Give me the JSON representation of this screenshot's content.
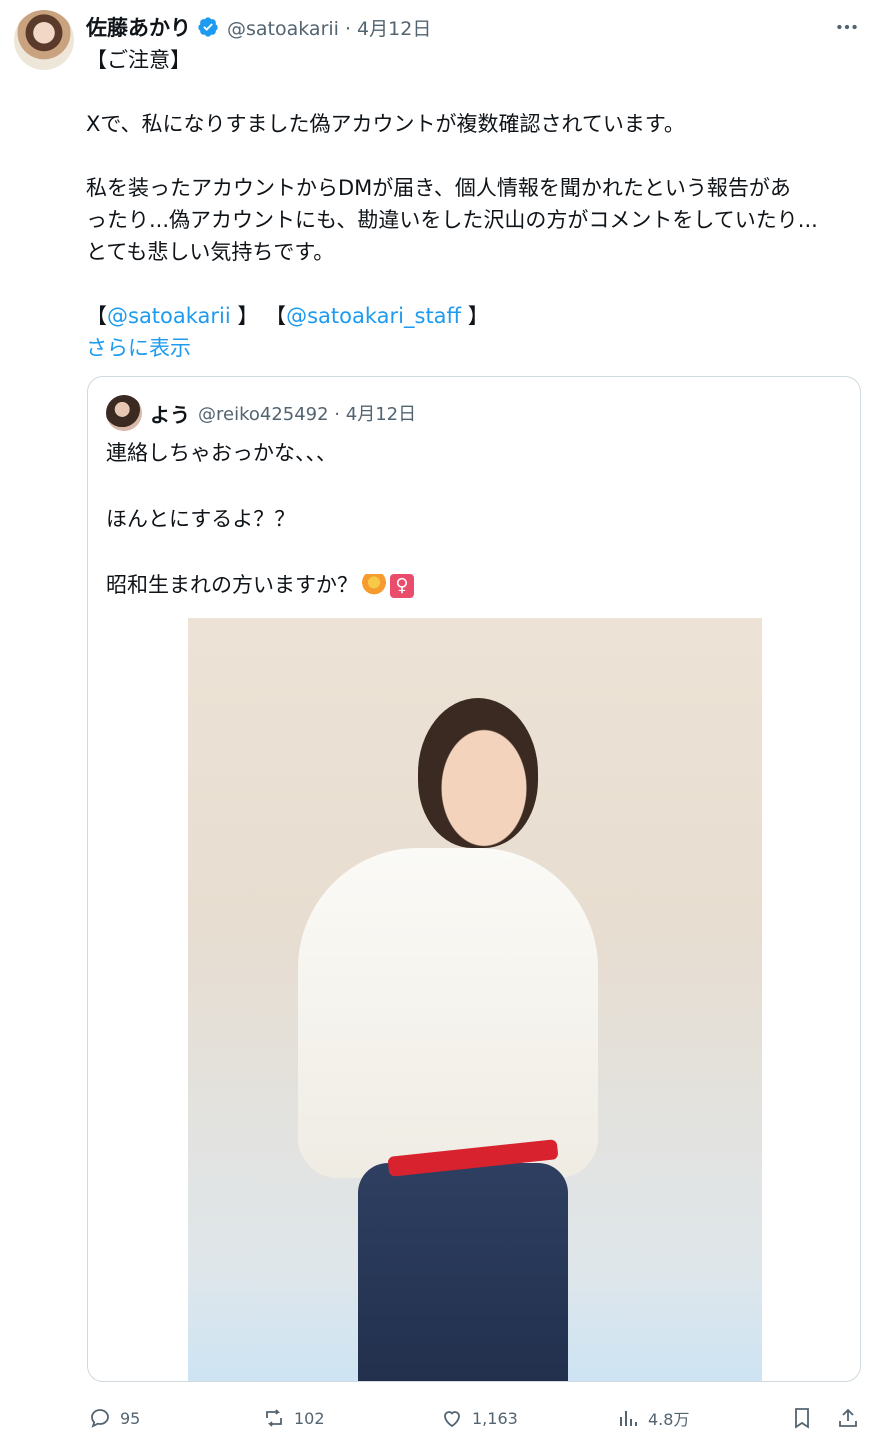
{
  "tweet": {
    "author_name": "佐藤あかり",
    "meta": "@satoakarii · 4月12日",
    "lines": [
      "【ご注意】",
      "",
      "Xで、私になりすました偽アカウントが複数確認されています。",
      "",
      "私を装ったアカウントからDMが届き、個人情報を聞かれたという報告があ",
      "ったり...偽アカウントにも、勘違いをした沢山の方がコメントをしていたり...",
      "とても悲しい気持ちです。",
      ""
    ],
    "mention_open_1": "【",
    "mention_1": "@satoakarii",
    "mention_close_1": " 】",
    "mention_open_2": " 【",
    "mention_2": "@satoakari_staff",
    "mention_close_2": " 】",
    "show_more": "さらに表示"
  },
  "quote": {
    "author_name": "よう",
    "meta": "@reiko425492 · 4月12日",
    "line1": "連絡しちゃおっかな、、、",
    "line2": "ほんとにするよ？？",
    "line3": "昭和生まれの方いますか？",
    "emoji_female_glyph": "♀"
  },
  "actions": {
    "replies": "95",
    "reposts": "102",
    "likes": "1,163",
    "views": "4.8万"
  },
  "colors": {
    "accent": "#1d9bf0",
    "secondary_text": "#536471",
    "border": "#cfd9de"
  }
}
